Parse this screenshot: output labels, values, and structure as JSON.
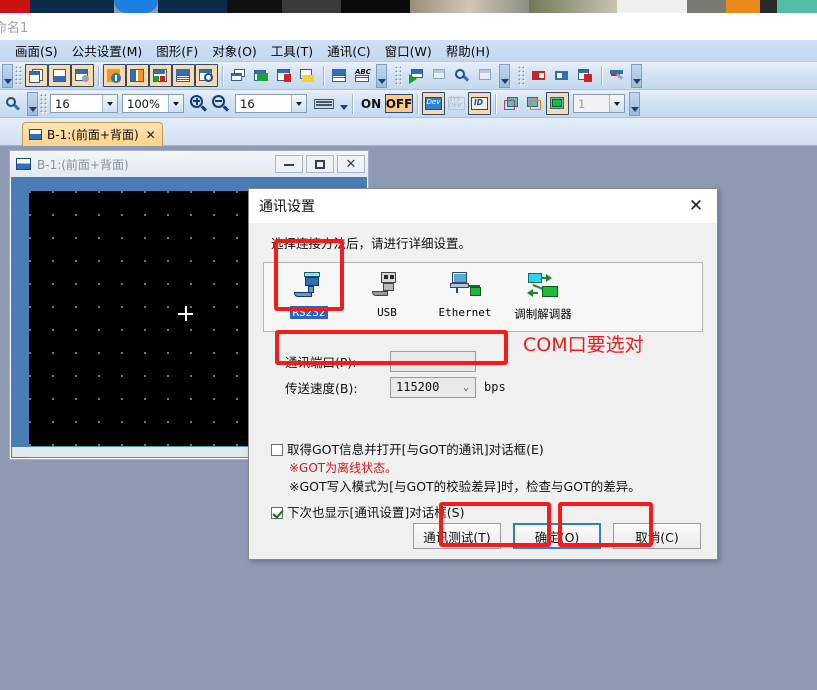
{
  "app": {
    "title": "命名1",
    "menu": [
      {
        "label": "画面(S)"
      },
      {
        "label": "公共设置(M)"
      },
      {
        "label": "图形(F)"
      },
      {
        "label": "对象(O)"
      },
      {
        "label": "工具(T)"
      },
      {
        "label": "通讯(C)"
      },
      {
        "label": "窗口(W)"
      },
      {
        "label": "帮助(H)"
      }
    ]
  },
  "toolbar2": {
    "font_size": "16",
    "zoom": "100%",
    "grid": "16",
    "on_label": "ON",
    "off_label": "OFF",
    "dev_label": "Dev",
    "sysdev_label": "SYS DEV",
    "id_label": "ID",
    "layer": "1"
  },
  "tabs": [
    {
      "label": "B-1:(前面+背面)",
      "close": "✕"
    }
  ],
  "child_window": {
    "title": "B-1:(前面+背面)",
    "minimize": "minimize",
    "maximize": "maximize",
    "close": "close"
  },
  "dialog": {
    "title": "通讯设置",
    "close": "✕",
    "hint": "选择连接方法后，请进行详细设置。",
    "connections": [
      {
        "label": "RS232",
        "selected": true
      },
      {
        "label": "USB",
        "selected": false
      },
      {
        "label": "Ethernet",
        "selected": false
      },
      {
        "label": "调制解调器",
        "selected": false
      }
    ],
    "port_label": "通讯端口(P):",
    "port_value": "",
    "speed_label": "传送速度(B):",
    "speed_value": "115200",
    "speed_unit": "bps",
    "checkbox_got": {
      "label": "取得GOT信息并打开[与GOT的通讯]对话框(E)",
      "checked": false,
      "note_red": "※GOT为离线状态。",
      "note_black": "※GOT写入模式为[与GOT的校验差异]时，检查与GOT的差异。"
    },
    "checkbox_show_next": {
      "label": "下次也显示[通讯设置]对话框(S)",
      "checked": true
    },
    "buttons": {
      "test": "通讯测试(T)",
      "ok": "确定(O)",
      "cancel": "取消(C)"
    }
  },
  "annotation": {
    "com_note": "COM口要选对",
    "color": "#f41b1b"
  },
  "colors": {
    "desktop": "#8e9ab4",
    "canvas": "#000000",
    "teal_band": "#469a9a",
    "selection_blue": "#2a66c8",
    "annotation_red": "#f41b1b"
  }
}
